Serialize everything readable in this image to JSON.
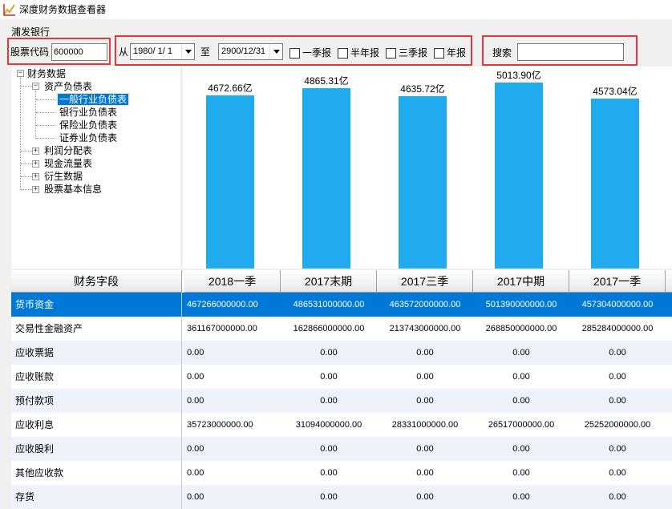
{
  "window": {
    "title": "深度财务数据查看器"
  },
  "company_name": "浦发银行",
  "filters": {
    "stock_code_label": "股票代码",
    "stock_code_value": "600000",
    "from_label": "从",
    "from_date": "1980/ 1/ 1",
    "to_label": "至",
    "to_date": "2900/12/31",
    "checkboxes": [
      {
        "label": "一季报",
        "checked": false
      },
      {
        "label": "半年报",
        "checked": false
      },
      {
        "label": "三季报",
        "checked": false
      },
      {
        "label": "年报",
        "checked": false
      }
    ],
    "search_label": "搜索",
    "search_value": ""
  },
  "tree": {
    "root": "财务数据",
    "balance_sheet": "资产负债表",
    "children": [
      "一般行业负债表",
      "银行业负债表",
      "保险业负债表",
      "证券业负债表"
    ],
    "selected": "一般行业负债表",
    "others": [
      "利润分配表",
      "现金流量表",
      "衍生数据",
      "股票基本信息"
    ]
  },
  "chart_data": {
    "type": "bar",
    "categories": [
      "2018一季",
      "2017末期",
      "2017三季",
      "2017中期",
      "2017一季"
    ],
    "values": [
      4672.66,
      4865.31,
      4635.72,
      5013.9,
      4573.04
    ],
    "data_labels": [
      "4672.66亿",
      "4865.31亿",
      "4635.72亿",
      "5013.90亿",
      "4573.04亿"
    ],
    "unit": "亿",
    "color": "#1fabee"
  },
  "table": {
    "field_header": "财务字段",
    "periods": [
      "2018一季",
      "2017末期",
      "2017三季",
      "2017中期",
      "2017一季"
    ],
    "rows": [
      {
        "field": "货币资金",
        "values": [
          "467266000000.00",
          "486531000000.00",
          "463572000000.00",
          "501390000000.00",
          "457304000000.00"
        ],
        "selected": true
      },
      {
        "field": "交易性金融资产",
        "values": [
          "361167000000.00",
          "162866000000.00",
          "213743000000.00",
          "268850000000.00",
          "285284000000.00"
        ]
      },
      {
        "field": "应收票据",
        "values": [
          "0.00",
          "0.00",
          "0.00",
          "0.00",
          "0.00"
        ]
      },
      {
        "field": "应收账款",
        "values": [
          "0.00",
          "0.00",
          "0.00",
          "0.00",
          "0.00"
        ]
      },
      {
        "field": "预付款项",
        "values": [
          "0.00",
          "0.00",
          "0.00",
          "0.00",
          "0.00"
        ]
      },
      {
        "field": "应收利息",
        "values": [
          "35723000000.00",
          "31094000000.00",
          "28331000000.00",
          "26517000000.00",
          "25252000000.00"
        ]
      },
      {
        "field": "应收股利",
        "values": [
          "0.00",
          "0.00",
          "0.00",
          "0.00",
          "0.00"
        ]
      },
      {
        "field": "其他应收款",
        "values": [
          "0.00",
          "0.00",
          "0.00",
          "0.00",
          "0.00"
        ]
      },
      {
        "field": "存货",
        "values": [
          "0.00",
          "0.00",
          "0.00",
          "0.00",
          "0.00"
        ]
      }
    ]
  },
  "colors": {
    "selection": "#0078d7",
    "highlight_box": "#e53935",
    "bar": "#1fabee",
    "alt_row": "#eef3fb"
  }
}
